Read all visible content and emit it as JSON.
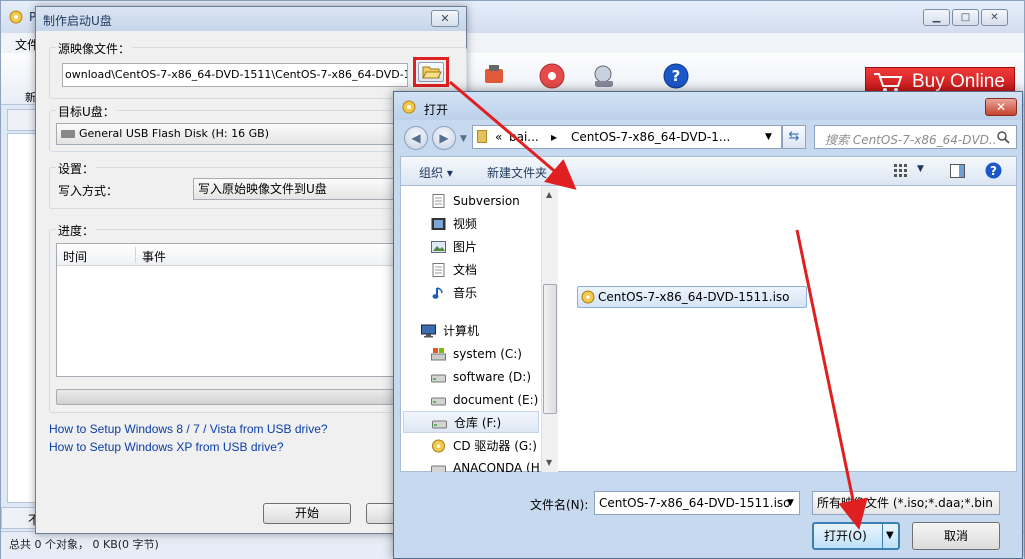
{
  "main": {
    "menu_first": "文件",
    "toolbar": {
      "new_label": "新",
      "items": [
        "",
        "",
        "",
        ""
      ]
    },
    "buy_online": "Buy Online",
    "status_left": "不",
    "status_text": "总共 0 个对象，  0 KB(0 字节)"
  },
  "write_dialog": {
    "title": "制作启动U盘",
    "close": "✕",
    "source_label": "源映像文件：",
    "source_path": "ownload\\CentOS-7-x86_64-DVD-1511\\CentOS-7-x86_64-DVD-1511.iso",
    "target_label": "目标U盘：",
    "target_value": "General USB Flash Disk (H: 16 GB)",
    "settings_label": "设置：",
    "write_mode_label": "写入方式：",
    "write_mode_value": "写入原始映像文件到U盘",
    "progress_label": "进度：",
    "log_columns": [
      "时间",
      "事件"
    ],
    "help_links": [
      "How to Setup Windows 8 / 7 / Vista from USB drive?",
      "How to Setup Windows XP from USB drive?"
    ],
    "start_button": "开始"
  },
  "open_dialog": {
    "title": "打开",
    "close": "✕",
    "address_crumbs": [
      "«",
      "bai...",
      "▸",
      "CentOS-7-x86_64-DVD-1..."
    ],
    "search_placeholder": "搜索 CentOS-7-x86_64-DVD...",
    "organize": "组织 ▾",
    "new_folder": "新建文件夹",
    "nav_items": [
      {
        "label": "Subversion",
        "icon": "document-icon"
      },
      {
        "label": "视频",
        "icon": "video-icon"
      },
      {
        "label": "图片",
        "icon": "picture-icon"
      },
      {
        "label": "文档",
        "icon": "document-icon"
      },
      {
        "label": "音乐",
        "icon": "music-icon"
      },
      {
        "label": "计算机",
        "icon": "computer-icon"
      },
      {
        "label": "system (C:)",
        "icon": "system-drive-icon"
      },
      {
        "label": "software (D:)",
        "icon": "drive-icon"
      },
      {
        "label": "document (E:)",
        "icon": "drive-icon"
      },
      {
        "label": "仓库 (F:)",
        "icon": "drive-icon"
      },
      {
        "label": "CD 驱动器 (G:)",
        "icon": "cd-icon"
      },
      {
        "label": "ANACONDA (H:",
        "icon": "drive-icon"
      }
    ],
    "file": "CentOS-7-x86_64-DVD-1511.iso",
    "filename_label": "文件名(N):",
    "filename_value": "CentOS-7-x86_64-DVD-1511.iso",
    "filetype_value": "所有映像文件 (*.iso;*.daa;*.bin",
    "open_button": "打开(O)",
    "cancel_button": "取消"
  },
  "colors": {
    "annotation_red": "#e02020",
    "link_blue": "#0a3ea8",
    "buy_online_red": "#d42020"
  }
}
